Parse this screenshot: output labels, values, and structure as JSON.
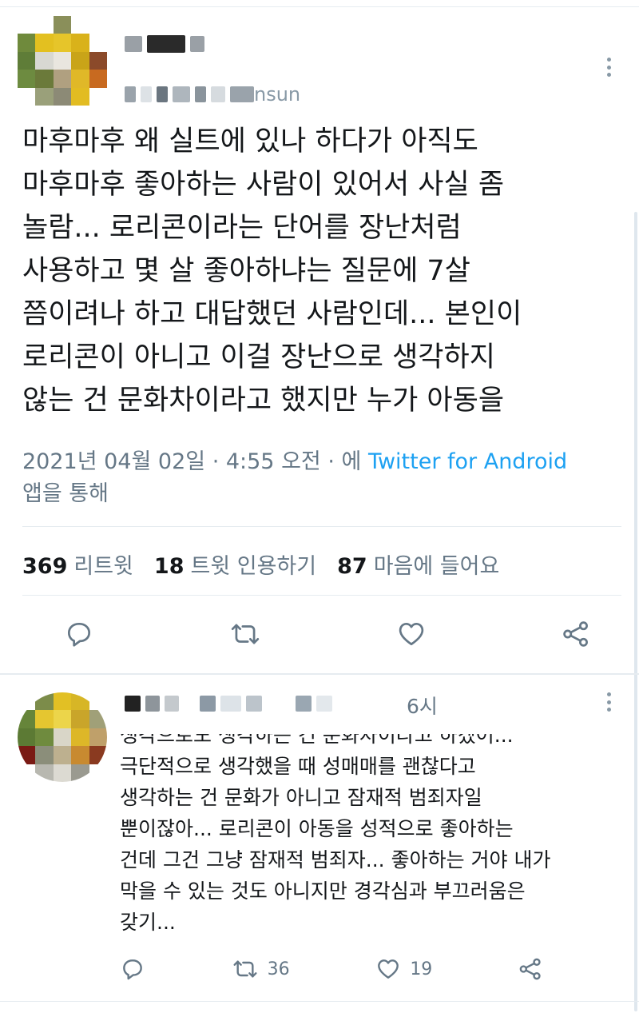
{
  "tweet": {
    "handle_fragment": "nsun",
    "text": "마후마후 왜 실트에 있나 하다가 아직도\n마후마후 좋아하는 사람이 있어서 사실 좀\n놀람... 로리콘이라는 단어를 장난처럼\n사용하고 몇 살 좋아하냐는 질문에 7살\n쯤이려나 하고 대답했던 사람인데... 본인이\n로리콘이 아니고 이걸 장난으로 생각하지\n않는 건 문화차이라고 했지만 누가 아동을",
    "date": "2021년 04월 02일 · 4:55 오전 · 에 ",
    "source": "Twitter for Android",
    "source_suffix": "앱을 통해"
  },
  "stats": {
    "retweets_count": "369",
    "retweets_label": "리트윗",
    "quotes_count": "18",
    "quotes_label": "트윗 인용하기",
    "likes_count": "87",
    "likes_label": "마음에 들어요"
  },
  "reply": {
    "time": "6시",
    "text": "생각으로도 생각하는 건 문화차이라고 하겠어...\n극단적으로 생각했을 때 성매매를 괜찮다고\n생각하는 건 문화가 아니고 잠재적 범죄자일\n뿐이잖아... 로리콘이 아동을 성적으로 좋아하는\n건데 그건 그냥 잠재적 범죄자... 좋아하는 거야 내가\n막을 수 있는 것도 아니지만 경각심과 부끄러움은\n갖기...",
    "retweet_count": "36",
    "like_count": "19"
  },
  "icons": {
    "reply": "reply-icon",
    "retweet": "retweet-icon",
    "like": "heart-icon",
    "share": "share-icon",
    "more": "more-icon"
  },
  "colors": {
    "link": "#1da1f2",
    "secondary_text": "#657786",
    "icon": "#657786",
    "divider": "#e6ecf0"
  }
}
